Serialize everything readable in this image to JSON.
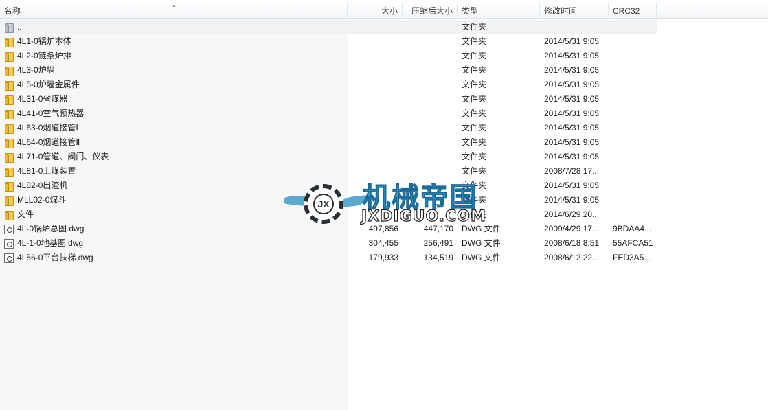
{
  "header": {
    "name": "名称",
    "size": "大小",
    "packed": "压缩后大小",
    "type": "类型",
    "modified": "修改时间",
    "crc": "CRC32"
  },
  "rows": [
    {
      "icon": "folder-up-icon",
      "name": "..",
      "size": "",
      "packed": "",
      "type": "文件夹",
      "modified": "",
      "crc": ""
    },
    {
      "icon": "folder-icon",
      "name": "4L1-0锅炉本体",
      "size": "",
      "packed": "",
      "type": "文件夹",
      "modified": "2014/5/31 9:05",
      "crc": ""
    },
    {
      "icon": "folder-icon",
      "name": "4L2-0链条炉排",
      "size": "",
      "packed": "",
      "type": "文件夹",
      "modified": "2014/5/31 9:05",
      "crc": ""
    },
    {
      "icon": "folder-icon",
      "name": "4L3-0炉墙",
      "size": "",
      "packed": "",
      "type": "文件夹",
      "modified": "2014/5/31 9:05",
      "crc": ""
    },
    {
      "icon": "folder-icon",
      "name": "4L5-0炉墙金属件",
      "size": "",
      "packed": "",
      "type": "文件夹",
      "modified": "2014/5/31 9:05",
      "crc": ""
    },
    {
      "icon": "folder-icon",
      "name": "4L31-0省煤器",
      "size": "",
      "packed": "",
      "type": "文件夹",
      "modified": "2014/5/31 9:05",
      "crc": ""
    },
    {
      "icon": "folder-icon",
      "name": "4L41-0空气预热器",
      "size": "",
      "packed": "",
      "type": "文件夹",
      "modified": "2014/5/31 9:05",
      "crc": ""
    },
    {
      "icon": "folder-icon",
      "name": "4L63-0烟道接管Ⅰ",
      "size": "",
      "packed": "",
      "type": "文件夹",
      "modified": "2014/5/31 9:05",
      "crc": ""
    },
    {
      "icon": "folder-icon",
      "name": "4L64-0烟道接管Ⅱ",
      "size": "",
      "packed": "",
      "type": "文件夹",
      "modified": "2014/5/31 9:05",
      "crc": ""
    },
    {
      "icon": "folder-icon",
      "name": "4L71-0管道、阀门、仪表",
      "size": "",
      "packed": "",
      "type": "文件夹",
      "modified": "2014/5/31 9:05",
      "crc": ""
    },
    {
      "icon": "folder-icon",
      "name": "4L81-0上煤装置",
      "size": "",
      "packed": "",
      "type": "文件夹",
      "modified": "2008/7/28 17...",
      "crc": ""
    },
    {
      "icon": "folder-icon",
      "name": "4L82-0出渣机",
      "size": "",
      "packed": "",
      "type": "文件夹",
      "modified": "2014/5/31 9:05",
      "crc": ""
    },
    {
      "icon": "folder-icon",
      "name": "MLL02-0煤斗",
      "size": "",
      "packed": "",
      "type": "文件夹",
      "modified": "2014/5/31 9:05",
      "crc": ""
    },
    {
      "icon": "folder-icon",
      "name": "文件",
      "size": "",
      "packed": "",
      "type": "文件夹",
      "modified": "2014/6/29 20...",
      "crc": ""
    },
    {
      "icon": "dwg-file-icon",
      "name": "4L-0锅炉总图.dwg",
      "size": "497,856",
      "packed": "447,170",
      "type": "DWG 文件",
      "modified": "2009/4/29 17...",
      "crc": "9BDAA4..."
    },
    {
      "icon": "dwg-file-icon",
      "name": "4L-1-0地基图.dwg",
      "size": "304,455",
      "packed": "256,491",
      "type": "DWG 文件",
      "modified": "2008/6/18 8:51",
      "crc": "55AFCA51"
    },
    {
      "icon": "dwg-file-icon",
      "name": "4L56-0平台扶梯.dwg",
      "size": "179,933",
      "packed": "134,519",
      "type": "DWG 文件",
      "modified": "2008/6/12 22...",
      "crc": "FED3A5..."
    }
  ],
  "watermark": {
    "emblem": "JX",
    "title": "机械帝国",
    "subtitle": "JXDIGUO.COM"
  }
}
